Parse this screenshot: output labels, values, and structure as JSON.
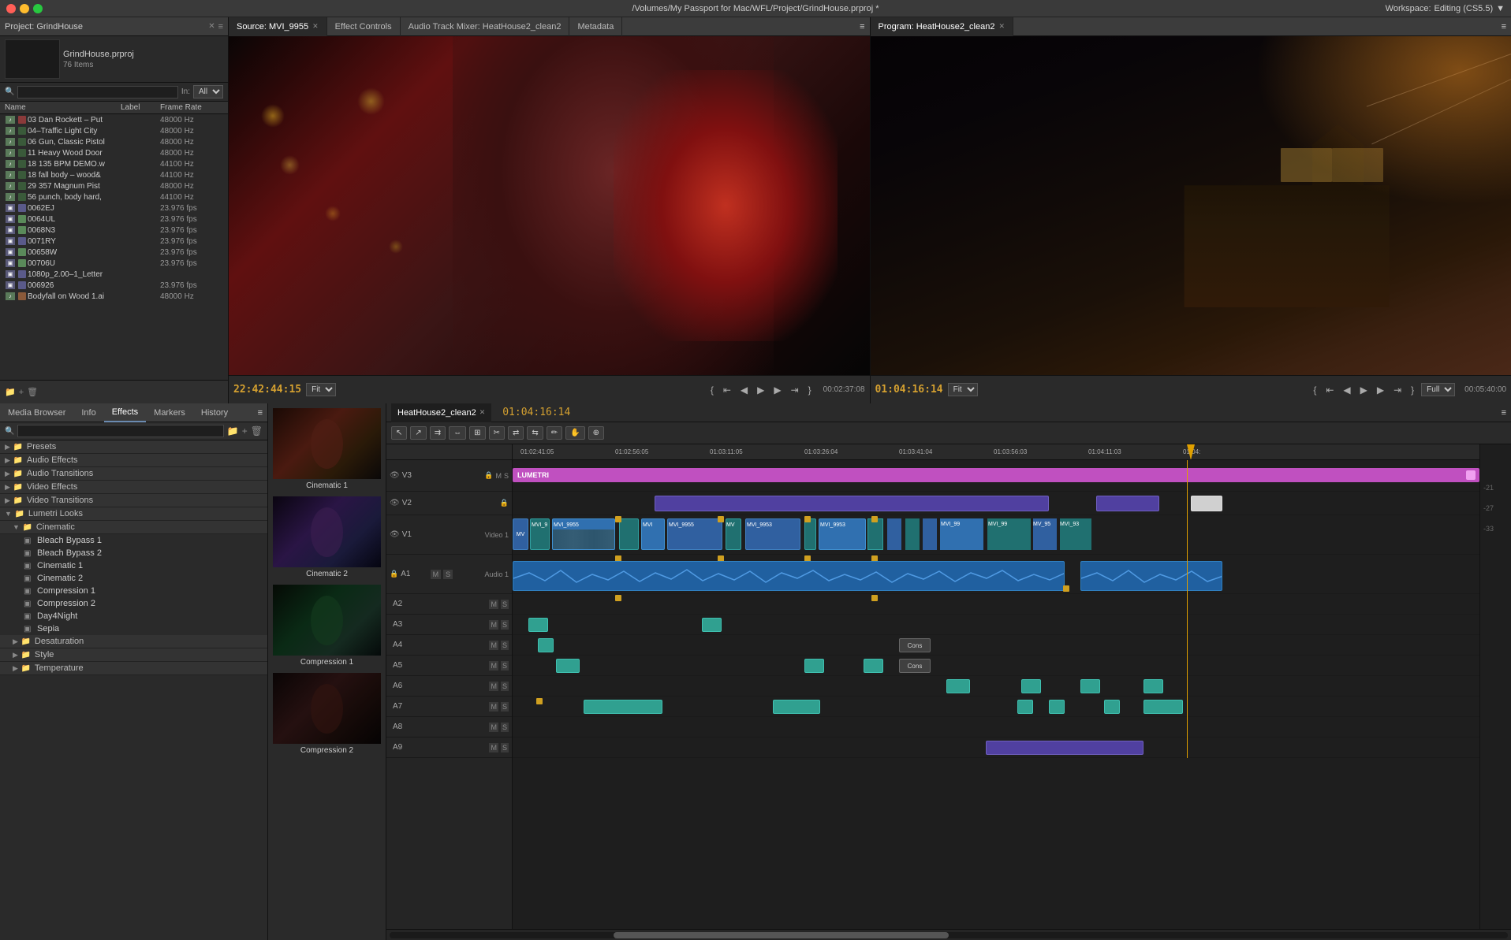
{
  "window": {
    "title": "/Volumes/My Passport for Mac/WFL/Project/GrindHouse.prproj *",
    "workspace_label": "Workspace:",
    "workspace_value": "Editing (CS5.5)"
  },
  "project_panel": {
    "title": "Project: GrindHouse",
    "items_count": "76 Items",
    "search_placeholder": "",
    "in_label": "In:",
    "in_value": "All",
    "project_name": "GrindHouse.prproj",
    "columns": {
      "name": "Name",
      "label": "Label",
      "frame_rate": "Frame Rate"
    },
    "items": [
      {
        "name": "03 Dan Rockett – Put",
        "type": "audio",
        "color": "#8a3a3a",
        "frame_rate": "48000 Hz"
      },
      {
        "name": "04–Traffic Light City",
        "type": "audio",
        "color": "#3a5a3a",
        "frame_rate": "48000 Hz"
      },
      {
        "name": "06 Gun, Classic Pistol",
        "type": "audio",
        "color": "#3a5a3a",
        "frame_rate": "48000 Hz"
      },
      {
        "name": "11 Heavy Wood Door",
        "type": "audio",
        "color": "#3a5a3a",
        "frame_rate": "48000 Hz"
      },
      {
        "name": "18 135 BPM DEMO.w",
        "type": "audio",
        "color": "#3a5a3a",
        "frame_rate": "44100 Hz"
      },
      {
        "name": "18 fall body – wood&",
        "type": "audio",
        "color": "#3a5a3a",
        "frame_rate": "44100 Hz"
      },
      {
        "name": "29 357 Magnum Pist",
        "type": "audio",
        "color": "#3a5a3a",
        "frame_rate": "48000 Hz"
      },
      {
        "name": "56 punch, body hard,",
        "type": "audio",
        "color": "#3a5a3a",
        "frame_rate": "44100 Hz"
      },
      {
        "name": "0062EJ",
        "type": "video",
        "color": "#5a5a8a",
        "frame_rate": "23.976 fps"
      },
      {
        "name": "0064UL",
        "type": "video",
        "color": "#5a8a5a",
        "frame_rate": "23.976 fps"
      },
      {
        "name": "0068N3",
        "type": "video",
        "color": "#5a8a5a",
        "frame_rate": "23.976 fps"
      },
      {
        "name": "0071RY",
        "type": "video",
        "color": "#5a5a8a",
        "frame_rate": "23.976 fps"
      },
      {
        "name": "00658W",
        "type": "video",
        "color": "#5a8a5a",
        "frame_rate": "23.976 fps"
      },
      {
        "name": "00706U",
        "type": "video",
        "color": "#5a8a5a",
        "frame_rate": "23.976 fps"
      },
      {
        "name": "1080p_2.00–1_Letter",
        "type": "video",
        "color": "#5a5a8a",
        "frame_rate": ""
      },
      {
        "name": "006926",
        "type": "video",
        "color": "#5a5a8a",
        "frame_rate": "23.976 fps"
      },
      {
        "name": "Bodyfall on Wood 1.ai",
        "type": "audio",
        "color": "#8a5a3a",
        "frame_rate": "48000 Hz"
      }
    ]
  },
  "source_panel": {
    "tabs": [
      {
        "label": "Source: MVI_9955",
        "active": true
      },
      {
        "label": "Effect Controls",
        "active": false
      },
      {
        "label": "Audio Track Mixer: HeatHouse2_clean2",
        "active": false
      },
      {
        "label": "Metadata",
        "active": false
      }
    ],
    "timecode": "22:42:44:15",
    "fit_label": "Fit",
    "timecode_right": "00:02:37:08"
  },
  "program_panel": {
    "tabs": [
      {
        "label": "Program: HeatHouse2_clean2",
        "active": true
      }
    ],
    "timecode": "01:04:16:14",
    "fit_label": "Fit",
    "full_label": "Full",
    "timecode_right": "00:05:40:00"
  },
  "effects_panel": {
    "tabs": [
      {
        "label": "Media Browser",
        "active": false
      },
      {
        "label": "Info",
        "active": false
      },
      {
        "label": "Effects",
        "active": true
      },
      {
        "label": "Markers",
        "active": false
      },
      {
        "label": "History",
        "active": false
      }
    ],
    "tree": [
      {
        "label": "Presets",
        "type": "folder",
        "expanded": false
      },
      {
        "label": "Audio Effects",
        "type": "folder",
        "expanded": false
      },
      {
        "label": "Audio Transitions",
        "type": "folder",
        "expanded": false
      },
      {
        "label": "Video Effects",
        "type": "folder",
        "expanded": true
      },
      {
        "label": "Video Transitions",
        "type": "folder",
        "expanded": false
      },
      {
        "label": "Lumetri Looks",
        "type": "folder",
        "expanded": true,
        "children": [
          {
            "label": "Cinematic",
            "type": "folder",
            "expanded": true,
            "children": [
              {
                "label": "Bleach Bypass 1",
                "type": "effect"
              },
              {
                "label": "Bleach Bypass 2",
                "type": "effect"
              },
              {
                "label": "Cinematic 1",
                "type": "effect"
              },
              {
                "label": "Cinematic 2",
                "type": "effect"
              },
              {
                "label": "Compression 1",
                "type": "effect"
              },
              {
                "label": "Compression 2",
                "type": "effect"
              },
              {
                "label": "Day4Night",
                "type": "effect"
              },
              {
                "label": "Sepia",
                "type": "effect"
              }
            ]
          },
          {
            "label": "Desaturation",
            "type": "folder",
            "expanded": false
          },
          {
            "label": "Style",
            "type": "folder",
            "expanded": false
          },
          {
            "label": "Temperature",
            "type": "folder",
            "expanded": false
          }
        ]
      }
    ]
  },
  "thumbnails": [
    {
      "label": "Cinematic 1",
      "style": "cin1"
    },
    {
      "label": "Cinematic 2",
      "style": "cin2"
    },
    {
      "label": "Compression 1",
      "style": "comp1"
    },
    {
      "label": "Compression 2",
      "style": "comp2"
    }
  ],
  "timeline": {
    "tab_label": "HeatHouse2_clean2",
    "timecode": "01:04:16:14",
    "ruler_marks": [
      "01:02:41:05",
      "01:02:56:05",
      "01:03:11:05",
      "01:03:26:04",
      "01:03:41:04",
      "01:03:56:03",
      "01:04:11:03",
      "01:04:"
    ],
    "tracks": [
      {
        "name": "V3",
        "type": "video"
      },
      {
        "name": "V2",
        "type": "video"
      },
      {
        "name": "V1",
        "type": "video",
        "label": "Video 1"
      },
      {
        "name": "A1",
        "type": "audio",
        "label": "Audio 1"
      },
      {
        "name": "A2",
        "type": "audio"
      },
      {
        "name": "A3",
        "type": "audio"
      },
      {
        "name": "A4",
        "type": "audio"
      },
      {
        "name": "A5",
        "type": "audio"
      },
      {
        "name": "A6",
        "type": "audio"
      },
      {
        "name": "A7",
        "type": "audio"
      },
      {
        "name": "A8",
        "type": "audio"
      },
      {
        "name": "A9",
        "type": "audio"
      }
    ],
    "lumetri_label": "LUMETRI",
    "cons_labels": [
      "Cons",
      "Cons"
    ]
  },
  "db_scale": [
    "-21",
    "-27",
    "-33"
  ],
  "icons": {
    "arrow_right": "▶",
    "arrow_down": "▼",
    "folder": "📁",
    "film": "▣",
    "audio": "♪",
    "close": "✕",
    "menu": "≡",
    "search": "🔍",
    "fit": "⊞",
    "safe": "⊡",
    "wrench": "⚙",
    "plus": "+",
    "minus": "−",
    "scissors": "✂",
    "razor": "⬧",
    "selection": "↖",
    "ripple": "⇉",
    "roll": "⇔",
    "rate": "≡",
    "slip": "⇄",
    "slide": "⇆",
    "pen": "✏",
    "hand": "✋",
    "zoom": "⊕"
  }
}
